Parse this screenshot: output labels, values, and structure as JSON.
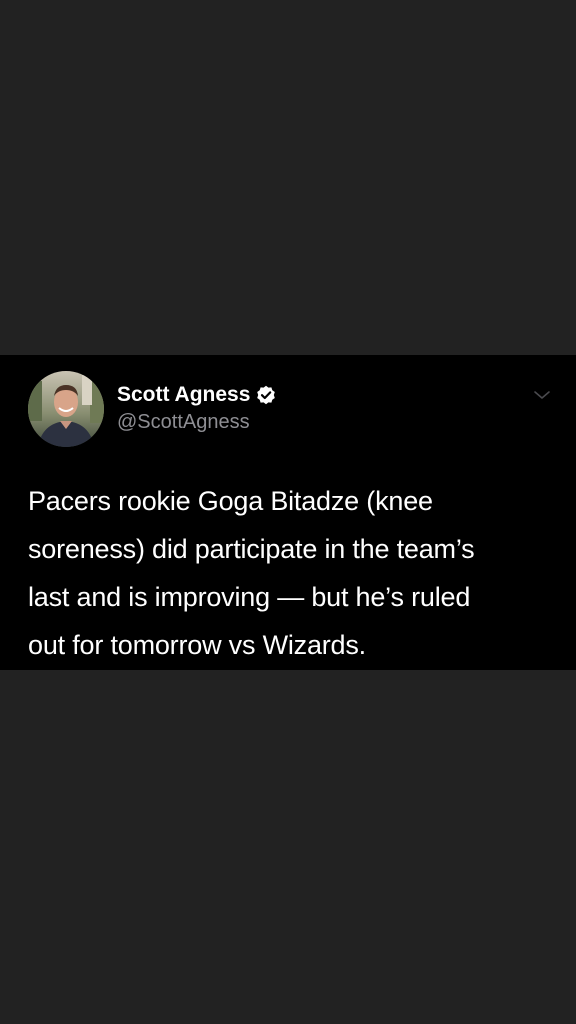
{
  "tweet": {
    "author": {
      "display_name": "Scott Agness",
      "handle": "@ScottAgness",
      "verified": true
    },
    "text_lines": [
      "Pacers rookie Goga Bitadze (knee",
      "soreness) did participate in the team’s",
      "last and is improving — but he’s ruled",
      "out for tomorrow vs Wizards."
    ],
    "icons": {
      "verified": "verified-badge-icon",
      "menu": "chevron-down-icon"
    }
  },
  "colors": {
    "page_background": "#222222",
    "card_background": "#000000",
    "primary_text": "#ffffff",
    "secondary_text": "#8e8e93"
  }
}
